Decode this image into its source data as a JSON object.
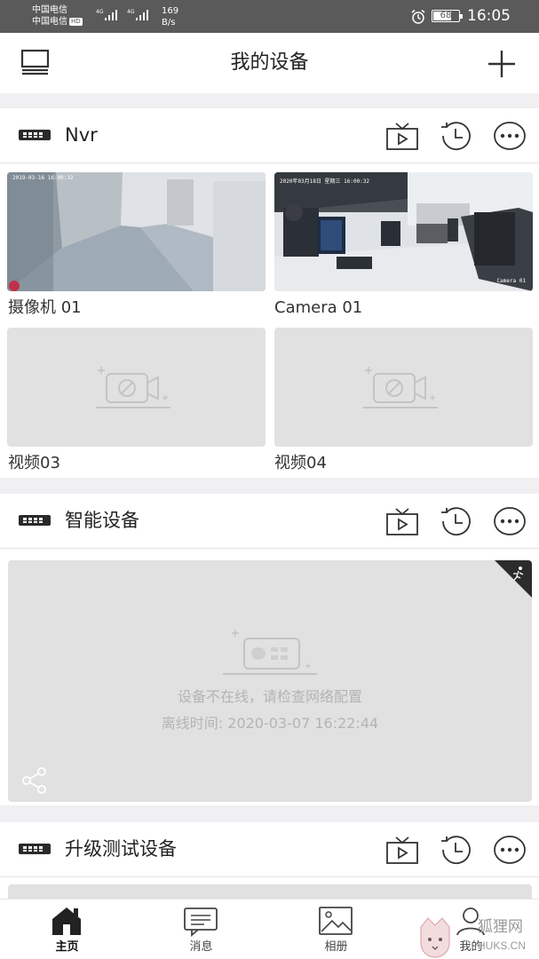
{
  "status_bar": {
    "carrier_1": "中国电信",
    "carrier_2": "中国电信",
    "hd_badge": "HD",
    "network_1": "4G",
    "network_2": "4G",
    "speed_value": "169",
    "speed_unit": "B/s",
    "battery": "68",
    "time": "16:05",
    "icons": [
      "signal-icon",
      "alarm-icon",
      "battery-icon"
    ]
  },
  "header": {
    "title": "我的设备",
    "left_icon": "device-list-icon",
    "right_icon": "add-icon"
  },
  "devices": [
    {
      "name": "Nvr",
      "actions": [
        "live-play-icon",
        "playback-icon",
        "more-icon"
      ],
      "channels": [
        {
          "label": "摄像机 01",
          "thumbnail": "hallway-camera-image",
          "timestamp": "2019-03-16 16:00:32"
        },
        {
          "label": "Camera 01",
          "thumbnail": "office-camera-image",
          "timestamp": "2020年03月18日 星期三 16:00:32",
          "overlay": "Camera 01"
        },
        {
          "label": "视频03",
          "thumbnail": "no-video-icon"
        },
        {
          "label": "视频04",
          "thumbnail": "no-video-icon"
        }
      ]
    },
    {
      "name": "智能设备",
      "actions": [
        "live-play-icon",
        "playback-icon",
        "more-icon"
      ],
      "offline_message": "设备不在线，请检查网络配置",
      "offline_time": "离线时间: 2020-03-07 16:22:44"
    },
    {
      "name": "升级测试设备",
      "actions": [
        "live-play-icon",
        "playback-icon",
        "more-icon"
      ]
    }
  ],
  "bottom_nav": [
    {
      "label": "主页",
      "icon": "home-icon",
      "active": true
    },
    {
      "label": "消息",
      "icon": "message-icon",
      "active": false
    },
    {
      "label": "相册",
      "icon": "album-icon",
      "active": false
    },
    {
      "label": "我的",
      "icon": "profile-icon",
      "active": false
    }
  ],
  "watermark": {
    "line1": "狐狸网",
    "line2": "HUKS.CN"
  },
  "colors": {
    "status_bar": "#5a5a5a",
    "page_background": "#f0f0f2",
    "tile_placeholder": "#e1e1e1",
    "offline_text": "#b4b4b4"
  }
}
